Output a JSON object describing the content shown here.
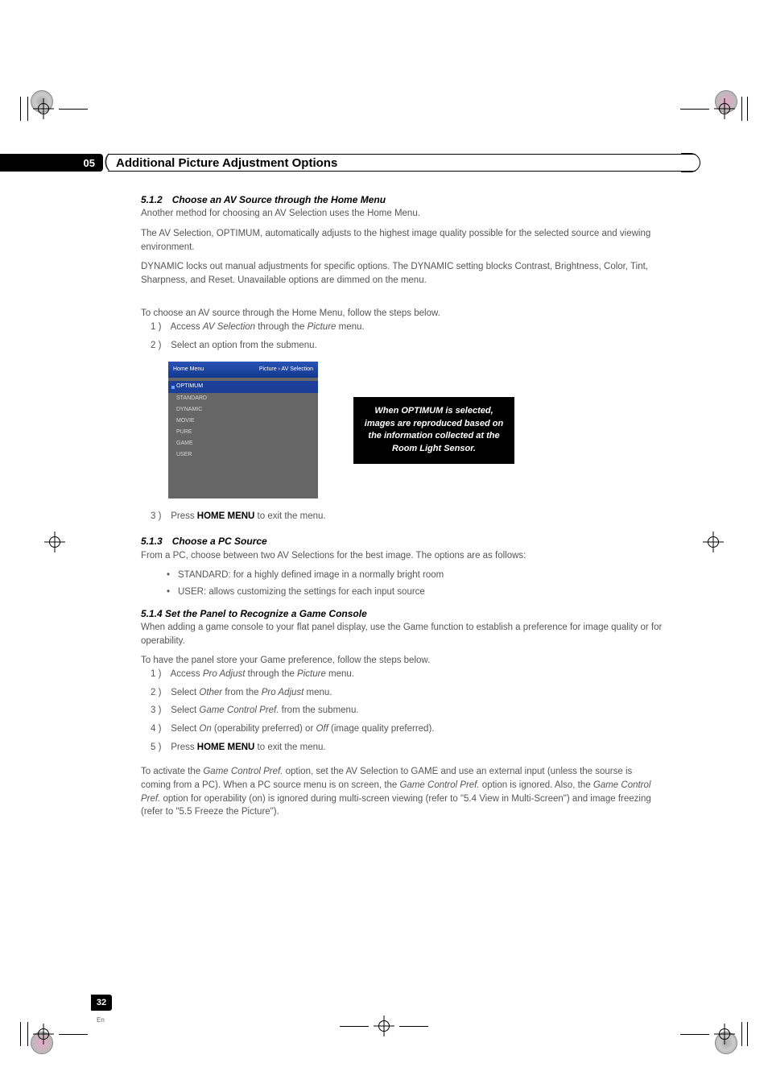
{
  "header": {
    "chapter_number": "05",
    "title": "Additional Picture Adjustment Options"
  },
  "s512": {
    "heading": "5.1.2 Choose an AV Source through the Home Menu",
    "p1": "Another method for choosing an AV Selection uses the Home Menu.",
    "p2": "The AV Selection, OPTIMUM, automatically adjusts to the highest image quality possible for the selected source and viewing environment.",
    "p3": "DYNAMIC locks out manual adjustments for specific options. The DYNAMIC setting blocks Contrast, Brightness, Color, Tint, Sharpness, and Reset.  Unavailable options are dimmed on the menu.",
    "intro": "To choose an AV source through the Home Menu, follow the steps below.",
    "step1_pre": "Access ",
    "step1_it1": "AV Selection",
    "step1_mid": " through the ",
    "step1_it2": "Picture",
    "step1_post": " menu.",
    "step2": "Select an option from the submenu.",
    "step3_pre": "Press ",
    "step3_bold": "HOME MENU",
    "step3_post": " to exit the menu."
  },
  "menu": {
    "title": "Home Menu",
    "breadcrumb": "Picture › AV Selection",
    "items": [
      "OPTIMUM",
      "STANDARD",
      "DYNAMIC",
      "MOVIE",
      "PURE",
      "GAME",
      "USER"
    ],
    "selected_index": 0
  },
  "callout": {
    "l1": "When OPTIMUM is selected,",
    "l2": "images are reproduced based on",
    "l3": "the information collected at the",
    "l4": "Room Light Sensor."
  },
  "s513": {
    "heading": "5.1.3 Choose a PC Source",
    "p1": "From a PC, choose between two AV Selections for the best image. The options are as follows:",
    "b1": "STANDARD: for a highly defined image in a normally bright room",
    "b2": "USER: allows customizing the settings for each input source"
  },
  "s514": {
    "heading": "5.1.4  Set the Panel to Recognize a Game Console",
    "p1": "When adding a game console to your flat panel display, use the Game function to establish a preference for image quality or for operability.",
    "intro": "To have the panel store your Game preference, follow the steps below.",
    "step1_pre": "Access ",
    "step1_it1": "Pro Adjust ",
    "step1_mid": " through the ",
    "step1_it2": "Picture",
    "step1_post": " menu.",
    "step2_pre": "Select ",
    "step2_it1": "Other",
    "step2_mid": " from the ",
    "step2_it2": "Pro Adjust",
    "step2_post": " menu.",
    "step3_pre": "Select ",
    "step3_it": "Game Control Pref.",
    "step3_post": "  from the submenu.",
    "step4_pre": "Select ",
    "step4_it1": "On",
    "step4_mid": " (operability preferred) or ",
    "step4_it2": "Off",
    "step4_post": " (image quality preferred).",
    "step5_pre": "Press ",
    "step5_bold": "HOME MENU",
    "step5_post": " to exit the menu.",
    "footer_a": "To activate the ",
    "footer_it1": "Game Control Pref.",
    "footer_b": " option, set the AV Selection to GAME and use an external input (unless the sourse is coming from a PC). When a PC source menu is on screen, the ",
    "footer_it2": "Game Control Pref.",
    "footer_c": " option is ignored. Also, the ",
    "footer_it3": "Game Control Pref.",
    "footer_d": " option for operability (on) is ignored during multi-screen viewing (refer to \"5.4 View in Multi-Screen\") and image freezing (refer to \"5.5 Freeze the Picture\")."
  },
  "footer": {
    "page": "32",
    "lang": "En"
  }
}
